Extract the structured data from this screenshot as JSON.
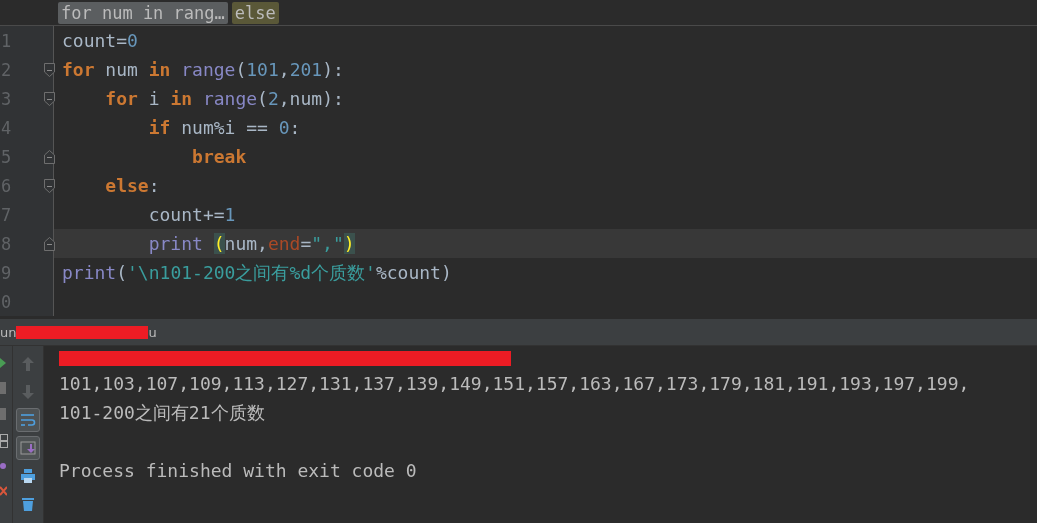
{
  "breadcrumbs": [
    {
      "label": "for num in rang…",
      "kind": "block"
    },
    {
      "label": "else",
      "kind": "current"
    }
  ],
  "editor": {
    "lines": [
      {
        "number": "1",
        "current": false,
        "fold_start": false,
        "fold_end": false,
        "tokens": [
          {
            "text": "count",
            "kind": "id"
          },
          {
            "text": "=",
            "kind": "op"
          },
          {
            "text": "0",
            "kind": "num"
          }
        ]
      },
      {
        "number": "2",
        "current": false,
        "fold_start": true,
        "fold_end": false,
        "tokens": [
          {
            "text": "for",
            "kind": "kw"
          },
          {
            "text": " num ",
            "kind": "id"
          },
          {
            "text": "in",
            "kind": "kw"
          },
          {
            "text": " range",
            "kind": "builtin"
          },
          {
            "text": "(",
            "kind": "op"
          },
          {
            "text": "101",
            "kind": "num"
          },
          {
            "text": ",",
            "kind": "op"
          },
          {
            "text": "201",
            "kind": "num"
          },
          {
            "text": "):",
            "kind": "op"
          }
        ]
      },
      {
        "number": "3",
        "current": false,
        "fold_start": true,
        "fold_end": false,
        "tokens": [
          {
            "text": "    for",
            "kind": "kw"
          },
          {
            "text": " i ",
            "kind": "id"
          },
          {
            "text": "in",
            "kind": "kw"
          },
          {
            "text": " range",
            "kind": "builtin"
          },
          {
            "text": "(",
            "kind": "op"
          },
          {
            "text": "2",
            "kind": "num"
          },
          {
            "text": ",num):",
            "kind": "op"
          }
        ]
      },
      {
        "number": "4",
        "current": false,
        "fold_start": false,
        "fold_end": false,
        "tokens": [
          {
            "text": "        if",
            "kind": "kw"
          },
          {
            "text": " num%i == ",
            "kind": "id"
          },
          {
            "text": "0",
            "kind": "num"
          },
          {
            "text": ":",
            "kind": "op"
          }
        ]
      },
      {
        "number": "5",
        "current": false,
        "fold_start": false,
        "fold_end": true,
        "tokens": [
          {
            "text": "            break",
            "kind": "kw"
          }
        ]
      },
      {
        "number": "6",
        "current": false,
        "fold_start": true,
        "fold_end": false,
        "tokens": [
          {
            "text": "    else",
            "kind": "kw"
          },
          {
            "text": ":",
            "kind": "op"
          }
        ]
      },
      {
        "number": "7",
        "current": false,
        "fold_start": false,
        "fold_end": false,
        "tokens": [
          {
            "text": "        count+=",
            "kind": "id"
          },
          {
            "text": "1",
            "kind": "num"
          }
        ]
      },
      {
        "number": "8",
        "current": true,
        "fold_start": false,
        "fold_end": true,
        "tokens": [
          {
            "text": "        print ",
            "kind": "builtin"
          },
          {
            "text": "(",
            "kind": "match"
          },
          {
            "text": "num,",
            "kind": "id"
          },
          {
            "text": "end",
            "kind": "param"
          },
          {
            "text": "=",
            "kind": "op"
          },
          {
            "text": "\",\"",
            "kind": "str"
          },
          {
            "text": ")",
            "kind": "match"
          }
        ]
      },
      {
        "number": "9",
        "current": false,
        "fold_start": false,
        "fold_end": false,
        "tokens": [
          {
            "text": "print",
            "kind": "builtin"
          },
          {
            "text": "(",
            "kind": "op"
          },
          {
            "text": "'\\n101-200之间有%d个质数'",
            "kind": "str"
          },
          {
            "text": "%count)",
            "kind": "id"
          }
        ]
      },
      {
        "number": "0",
        "current": false,
        "fold_start": false,
        "fold_end": false
      }
    ]
  },
  "run_panel": {
    "tab_label_start": "un",
    "tab_label_end": "u",
    "toolbar": [
      {
        "kind": "up",
        "on": false
      },
      {
        "kind": "down",
        "on": false
      },
      {
        "kind": "wrap",
        "on": true
      },
      {
        "kind": "scroll",
        "on": true
      },
      {
        "kind": "print",
        "on": false
      },
      {
        "kind": "trash",
        "on": false
      }
    ],
    "output": [
      [
        "101,103,107,109,113,127,131,137,139,149,151,157,163,167,173,179,181,191,193,197,199,",
        "101-200之间有21个质数"
      ],
      [
        "Process finished with exit code 0"
      ]
    ]
  }
}
